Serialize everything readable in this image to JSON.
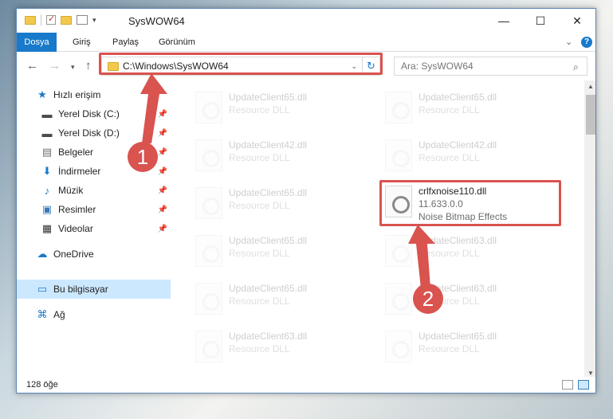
{
  "window": {
    "title": "SysWOW64"
  },
  "ribbon": {
    "tabs": [
      "Dosya",
      "Giriş",
      "Paylaş",
      "Görünüm"
    ]
  },
  "address": {
    "path": "C:\\Windows\\SysWOW64"
  },
  "search": {
    "placeholder": "Ara: SysWOW64"
  },
  "nav": {
    "quick_access": "Hızlı erişim",
    "items": [
      {
        "label": "Yerel Disk (C:)",
        "icon": "drive-icon"
      },
      {
        "label": "Yerel Disk (D:)",
        "icon": "drive-icon"
      },
      {
        "label": "Belgeler",
        "icon": "documents-icon"
      },
      {
        "label": "İndirmeler",
        "icon": "download-icon"
      },
      {
        "label": "Müzik",
        "icon": "music-icon"
      },
      {
        "label": "Resimler",
        "icon": "pictures-icon"
      },
      {
        "label": "Videolar",
        "icon": "video-icon"
      }
    ],
    "onedrive": "OneDrive",
    "this_pc": "Bu bilgisayar",
    "network": "Ağ"
  },
  "files": [
    {
      "name": "UpdateClient65.dll",
      "type": "Resource DLL"
    },
    {
      "name": "UpdateClient65.dll",
      "type": "Resource DLL"
    },
    {
      "name": "UpdateClient42.dll",
      "type": "Resource DLL"
    },
    {
      "name": "UpdateClient42.dll",
      "type": "Resource DLL"
    },
    {
      "name": "UpdateClient65.dll",
      "type": "Resource DLL"
    },
    {
      "name": "crlfxnoise110.dll",
      "version": "11.633.0.0",
      "type": "Noise Bitmap Effects"
    },
    {
      "name": "UpdateClient65.dll",
      "type": "Resource DLL"
    },
    {
      "name": "UpdateClient63.dll",
      "type": "Resource DLL"
    },
    {
      "name": "UpdateClient65.dll",
      "type": "Resource DLL"
    },
    {
      "name": "UpdateClient63.dll",
      "type": "Resource DLL"
    },
    {
      "name": "UpdateClient63.dll",
      "type": "Resource DLL"
    },
    {
      "name": "UpdateClient65.dll",
      "type": "Resource DLL"
    }
  ],
  "status": {
    "count": "128 öğe"
  },
  "callouts": [
    "1",
    "2"
  ],
  "colors": {
    "accent": "#1979ca",
    "highlight": "#d9534f",
    "selection": "#cce8ff"
  }
}
